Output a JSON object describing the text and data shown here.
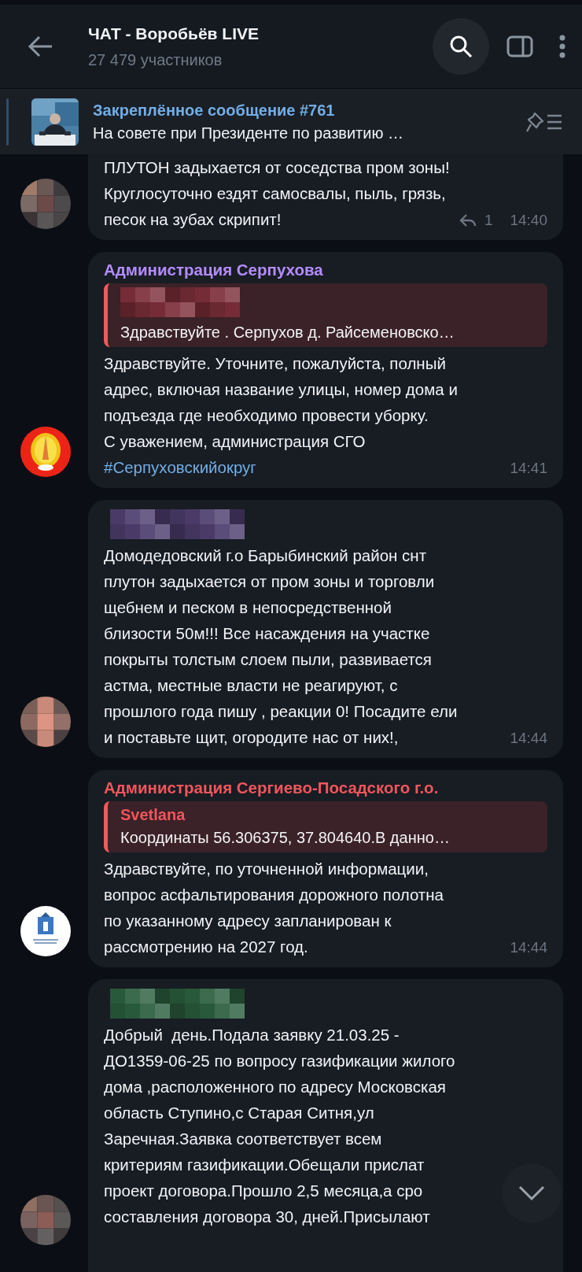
{
  "header": {
    "title": "ЧАТ - Воробьёв LIVE",
    "subtitle": "27 479 участников"
  },
  "pinned": {
    "title": "Закреплённое сообщение #761",
    "text": "На совете при Президенте по развитию …"
  },
  "messages": [
    {
      "avatar": {
        "kind": "pixelated"
      },
      "text": "ПЛУТОН задыхается от соседства пром зоны!\nКруглосуточно ездят самосвалы, пыль, грязь,\nпесок на зубах скрипит!",
      "replies": "1",
      "time": "14:40"
    },
    {
      "avatar": {
        "kind": "red-emblem"
      },
      "sender": {
        "kind": "name",
        "name": "Администрация Серпухова",
        "color": "#b48cff"
      },
      "reply": {
        "author": {
          "kind": "redacted",
          "color": "#7d2f3a"
        },
        "text": "Здравствуйте . Серпухов д. Райсеменовско…"
      },
      "text": "Здравствуйте. Уточните, пожалуйста, полный\nадрес, включая название улицы, номер дома и\nподъезда где необходимо провести уборку.\nС уважением, администрация СГО",
      "hashtag": "#Серпуховскийокруг",
      "time": "14:41"
    },
    {
      "avatar": {
        "kind": "pixelated"
      },
      "sender": {
        "kind": "redacted",
        "color": "#4d3e6e"
      },
      "text": "Домодедовский г.о Барыбинский район снт\nплутон задыхается от пром зоны и торговли\nщебнем и песком в непосредственной\nблизости 50м!!! Все насаждения на участке\nпокрыты толстым слоем пыли, развивается\nастма, местные власти не реагируют, с\nпрошлого года пишу , реакции 0! Посадите ели\nи поставьте щит, огородите нас от них!,",
      "time": "14:44"
    },
    {
      "avatar": {
        "kind": "white-emblem"
      },
      "sender": {
        "kind": "name",
        "name": "Администрация Сергиево-Посадского г.о.",
        "color": "#f0565b"
      },
      "reply": {
        "author": {
          "kind": "name",
          "name": "Svetlana",
          "color": "#f0565b"
        },
        "text": "Координаты 56.306375, 37.804640.В данно…"
      },
      "text": "Здравствуйте, по уточненной информации,\nвопрос асфальтирования дорожного полотна\nпо указанному адресу запланирован к\nрассмотрению на 2027 год.",
      "time": "14:44"
    },
    {
      "avatar": {
        "kind": "pixelated"
      },
      "sender": {
        "kind": "redacted",
        "color": "#2b5e3e"
      },
      "text": "Добрый  день.Подала заявку 21.03.25 -\nДО1359-06-25 по вопросу газификации жилого\nдома ,расположенного по адресу Московская\nобласть Ступино,с Старая Ситня,ул\nЗаречная.Заявка соответствует всем\nкритериям газификации.Обещали прислат\nпроект договора.Прошло 2,5 месяца,а сро\nсоставления договора 30, дней.Присылают"
    }
  ]
}
